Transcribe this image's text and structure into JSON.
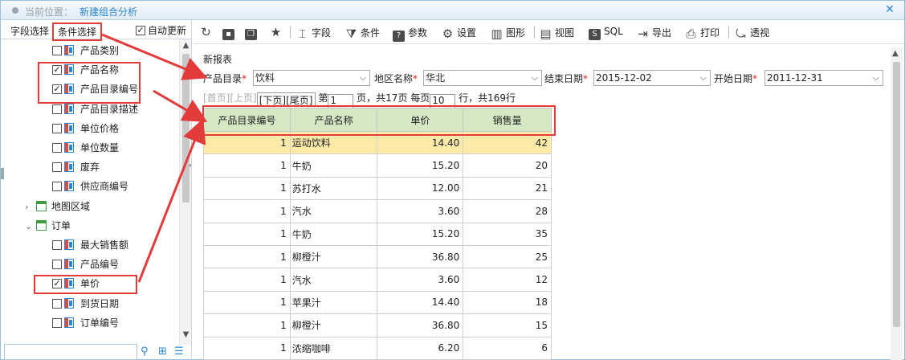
{
  "titlebar": {
    "location_label": "当前位置：",
    "location_value": "新建组合分析",
    "close_icon": "close-icon"
  },
  "left": {
    "tab_fields": "字段选择",
    "tab_conditions": "条件选择",
    "auto_update": "自动更新",
    "tree": [
      {
        "label": "产品类别",
        "checked": false,
        "kind": "field"
      },
      {
        "label": "产品名称",
        "checked": true,
        "kind": "field"
      },
      {
        "label": "产品目录编号",
        "checked": true,
        "kind": "field"
      },
      {
        "label": "产品目录描述",
        "checked": false,
        "kind": "field"
      },
      {
        "label": "单位价格",
        "checked": false,
        "kind": "field"
      },
      {
        "label": "单位数量",
        "checked": false,
        "kind": "field"
      },
      {
        "label": "废弃",
        "checked": false,
        "kind": "field"
      },
      {
        "label": "供应商编号",
        "checked": false,
        "kind": "field"
      },
      {
        "label": "地图区域",
        "kind": "table",
        "expanded": false
      },
      {
        "label": "订单",
        "kind": "table",
        "expanded": true
      },
      {
        "label": "最大销售额",
        "checked": false,
        "kind": "field"
      },
      {
        "label": "产品编号",
        "checked": false,
        "kind": "field"
      },
      {
        "label": "单价",
        "checked": true,
        "kind": "field"
      },
      {
        "label": "到货日期",
        "checked": false,
        "kind": "field"
      },
      {
        "label": "订单编号",
        "checked": false,
        "kind": "field"
      }
    ]
  },
  "toolbar": {
    "fields": "字段",
    "conditions": "条件",
    "params": "参数",
    "settings": "设置",
    "chart": "图形",
    "view": "视图",
    "sql": "SQL",
    "export": "导出",
    "print": "打印",
    "pivot": "透视"
  },
  "report": {
    "title": "新报表",
    "params": {
      "catalog_label": "产品目录",
      "catalog_value": "饮料",
      "region_label": "地区名称",
      "region_value": "华北",
      "end_label": "结束日期",
      "end_value": "2015-12-02",
      "start_label": "开始日期",
      "start_value": "2011-12-31"
    },
    "pager": {
      "first": "[首页]",
      "prev": "[上页]",
      "next": "[下页]",
      "last": "[尾页]",
      "page_prefix": "第",
      "page_value": "1",
      "page_suffix": "页，共17页 每页",
      "per_page": "10",
      "rows_suffix": "行，共169行"
    },
    "columns": [
      "产品目录编号",
      "产品名称",
      "单价",
      "销售量"
    ],
    "rows": [
      [
        "1",
        "运动饮料",
        "14.40",
        "42"
      ],
      [
        "1",
        "牛奶",
        "15.20",
        "20"
      ],
      [
        "1",
        "苏打水",
        "12.00",
        "21"
      ],
      [
        "1",
        "汽水",
        "3.60",
        "28"
      ],
      [
        "1",
        "牛奶",
        "15.20",
        "35"
      ],
      [
        "1",
        "柳橙汁",
        "36.80",
        "25"
      ],
      [
        "1",
        "汽水",
        "3.60",
        "12"
      ],
      [
        "1",
        "苹果汁",
        "14.40",
        "18"
      ],
      [
        "1",
        "柳橙汁",
        "36.80",
        "15"
      ],
      [
        "1",
        "浓缩咖啡",
        "6.20",
        "6"
      ]
    ]
  },
  "colors": {
    "accent": "#2c86d6",
    "highlight": "#e33a3a",
    "header_bg": "#d6e7c4",
    "selected_row": "#fde9a8"
  }
}
